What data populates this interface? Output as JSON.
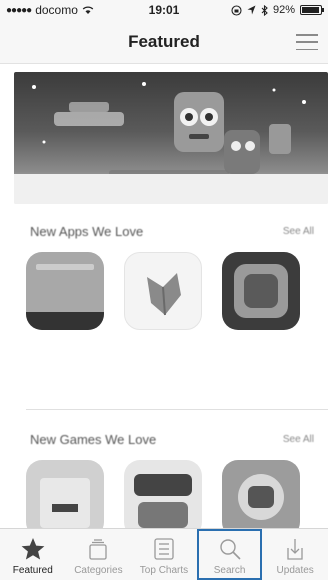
{
  "status_bar": {
    "carrier": "docomo",
    "time": "19:01",
    "battery": "92%",
    "battery_level": 0.92
  },
  "nav": {
    "title": "Featured",
    "list_icon": "list-icon"
  },
  "sections": [
    {
      "title": "New Apps We Love",
      "see_all": "See All",
      "apps": [
        {
          "name": "",
          "sub": ""
        },
        {
          "name": "",
          "sub": ""
        },
        {
          "name": "",
          "sub": ""
        }
      ]
    },
    {
      "title": "New Games We Love",
      "see_all": "See All",
      "apps": [
        {
          "name": "",
          "sub": ""
        },
        {
          "name": "",
          "sub": ""
        },
        {
          "name": "",
          "sub": ""
        }
      ]
    }
  ],
  "tabs": [
    {
      "label": "Featured",
      "icon": "star-icon",
      "active": true
    },
    {
      "label": "Categories",
      "icon": "categories-icon",
      "active": false
    },
    {
      "label": "Top Charts",
      "icon": "top-charts-icon",
      "active": false
    },
    {
      "label": "Search",
      "icon": "search-icon",
      "active": false
    },
    {
      "label": "Updates",
      "icon": "updates-icon",
      "active": false
    }
  ],
  "colors": {
    "highlight": "#2a6fb0"
  }
}
